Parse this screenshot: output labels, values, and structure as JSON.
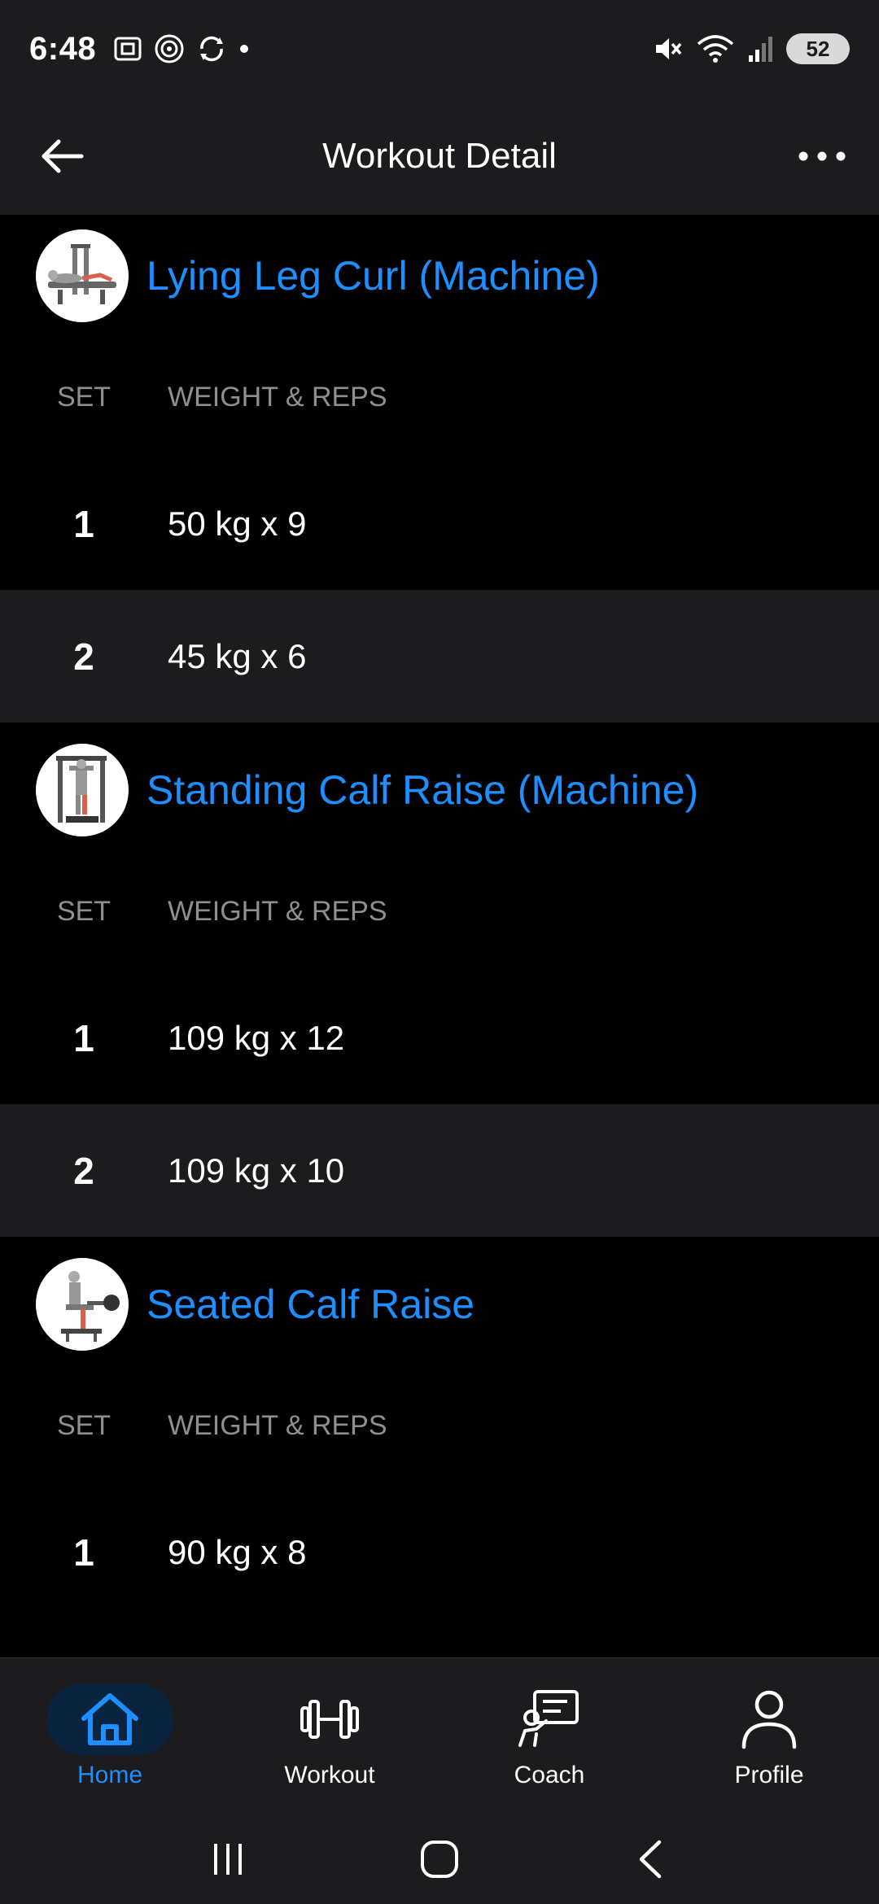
{
  "status": {
    "time": "6:48",
    "battery": "52"
  },
  "header": {
    "title": "Workout Detail"
  },
  "columns": {
    "set": "SET",
    "weight_reps": "WEIGHT & REPS"
  },
  "exercises": [
    {
      "name": "Lying Leg Curl (Machine)",
      "sets": [
        {
          "num": "1",
          "value": "50 kg x 9"
        },
        {
          "num": "2",
          "value": "45 kg x 6"
        }
      ]
    },
    {
      "name": "Standing Calf Raise (Machine)",
      "sets": [
        {
          "num": "1",
          "value": "109 kg x 12"
        },
        {
          "num": "2",
          "value": "109 kg x 10"
        }
      ]
    },
    {
      "name": "Seated Calf Raise",
      "sets": [
        {
          "num": "1",
          "value": "90 kg x 8"
        }
      ]
    }
  ],
  "nav": {
    "items": [
      {
        "label": "Home",
        "icon": "home-icon",
        "active": true
      },
      {
        "label": "Workout",
        "icon": "dumbbell-icon",
        "active": false
      },
      {
        "label": "Coach",
        "icon": "coach-icon",
        "active": false
      },
      {
        "label": "Profile",
        "icon": "profile-icon",
        "active": false
      }
    ]
  },
  "colors": {
    "accent": "#1e8fff",
    "surface": "#1c1c1e",
    "background": "#000000"
  }
}
